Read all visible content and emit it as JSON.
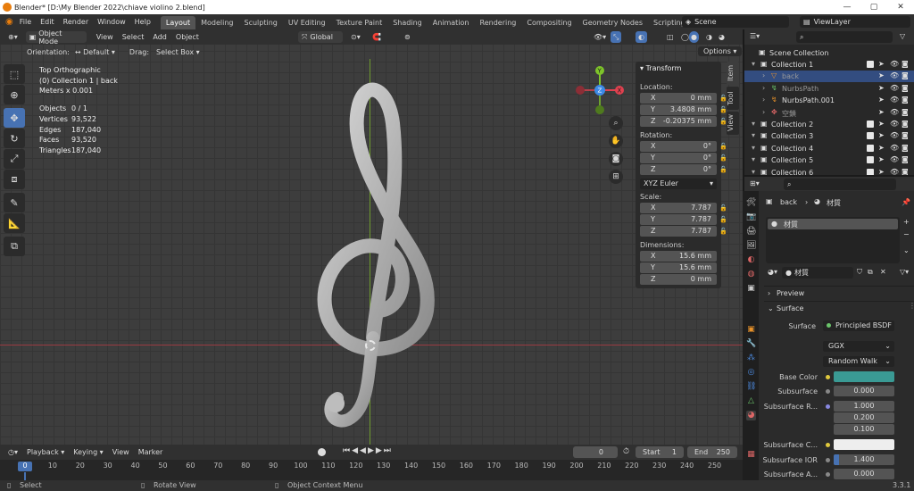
{
  "title": "Blender* [D:\\My Blender 2022\\chiave violino 2.blend]",
  "menu": [
    "File",
    "Edit",
    "Render",
    "Window",
    "Help"
  ],
  "workspaces": [
    "Layout",
    "Modeling",
    "Sculpting",
    "UV Editing",
    "Texture Paint",
    "Shading",
    "Animation",
    "Rendering",
    "Compositing",
    "Geometry Nodes",
    "Scripting"
  ],
  "add_workspace": "+",
  "scene": "Scene",
  "view_layer": "ViewLayer",
  "viewport_header": {
    "mode": "Object Mode",
    "menus": [
      "View",
      "Select",
      "Add",
      "Object"
    ],
    "transform_orientation": "Global"
  },
  "tool_settings": {
    "orientation_label": "Orientation:",
    "orientation_value": "Default",
    "drag_label": "Drag:",
    "drag_value": "Select Box",
    "options": "Options"
  },
  "overlay_info": {
    "view_name": "Top Orthographic",
    "collection_line": "(0) Collection 1 | back",
    "scale_line": "Meters x 0.001",
    "stats": [
      {
        "label": "Objects",
        "value": "0 / 1"
      },
      {
        "label": "Vertices",
        "value": "93,522"
      },
      {
        "label": "Edges",
        "value": "187,040"
      },
      {
        "label": "Faces",
        "value": "93,520"
      },
      {
        "label": "Triangles",
        "value": "187,040"
      }
    ]
  },
  "gizmo": {
    "x": "X",
    "y": "Y",
    "z": "Z"
  },
  "transform_panel": {
    "title": "Transform",
    "location_label": "Location:",
    "location": [
      {
        "axis": "X",
        "value": "0 mm"
      },
      {
        "axis": "Y",
        "value": "3.4808 mm"
      },
      {
        "axis": "Z",
        "value": "-0.20375 mm"
      }
    ],
    "rotation_label": "Rotation:",
    "rotation": [
      {
        "axis": "X",
        "value": "0°"
      },
      {
        "axis": "Y",
        "value": "0°"
      },
      {
        "axis": "Z",
        "value": "0°"
      }
    ],
    "rotation_mode": "XYZ Euler",
    "scale_label": "Scale:",
    "scale": [
      {
        "axis": "X",
        "value": "7.787"
      },
      {
        "axis": "Y",
        "value": "7.787"
      },
      {
        "axis": "Z",
        "value": "7.787"
      }
    ],
    "dimensions_label": "Dimensions:",
    "dimensions": [
      {
        "axis": "X",
        "value": "15.6 mm"
      },
      {
        "axis": "Y",
        "value": "15.6 mm"
      },
      {
        "axis": "Z",
        "value": "0 mm"
      }
    ]
  },
  "side_tabs": [
    "Item",
    "Tool",
    "View"
  ],
  "timeline": {
    "menus": [
      "Playback",
      "Keying",
      "View",
      "Marker"
    ],
    "current_frame": "0",
    "start_label": "Start",
    "start": "1",
    "end_label": "End",
    "end": "250",
    "ticks": [
      "0",
      "10",
      "20",
      "30",
      "40",
      "50",
      "60",
      "70",
      "80",
      "90",
      "100",
      "110",
      "120",
      "130",
      "140",
      "150",
      "160",
      "170",
      "180",
      "190",
      "200",
      "210",
      "220",
      "230",
      "240",
      "250"
    ]
  },
  "statusbar": {
    "select": "Select",
    "rotate": "Rotate View",
    "context": "Object Context Menu",
    "version": "3.3.1"
  },
  "outliner": {
    "root": "Scene Collection",
    "rows": [
      {
        "name": "Collection 1",
        "indent": 1
      },
      {
        "name": "back",
        "indent": 2
      },
      {
        "name": "NurbsPath",
        "indent": 2
      },
      {
        "name": "NurbsPath.001",
        "indent": 2
      },
      {
        "name": "空鎖",
        "indent": 2
      },
      {
        "name": "Collection 2",
        "indent": 1
      },
      {
        "name": "Collection 3",
        "indent": 1
      },
      {
        "name": "Collection 4",
        "indent": 1
      },
      {
        "name": "Collection 5",
        "indent": 1
      },
      {
        "name": "Collection 6",
        "indent": 1
      }
    ]
  },
  "properties": {
    "breadcrumb_object": "back",
    "breadcrumb_material": "材質",
    "slot_name": "材質",
    "material_name": "材質",
    "preview_label": "Preview",
    "surface_section": "Surface",
    "surface_label": "Surface",
    "surface_value": "Principled BSDF",
    "distribution": "GGX",
    "subsurface_method": "Random Walk",
    "rows": [
      {
        "label": "Base Color",
        "value": ""
      },
      {
        "label": "Subsurface",
        "value": "0.000"
      },
      {
        "label": "Subsurface R...",
        "value": "1.000"
      },
      {
        "label": "",
        "value": "0.200"
      },
      {
        "label": "",
        "value": "0.100"
      },
      {
        "label": "Subsurface C...",
        "value": ""
      },
      {
        "label": "Subsurface IOR",
        "value": "1.400"
      },
      {
        "label": "Subsurface A...",
        "value": "0.000"
      }
    ]
  },
  "colors": {
    "base_color": "#3a9a94",
    "active_blue": "#4772b3",
    "x_axis": "#e0414f",
    "y_axis": "#7ec42a",
    "z_axis": "#3d8ae6"
  }
}
